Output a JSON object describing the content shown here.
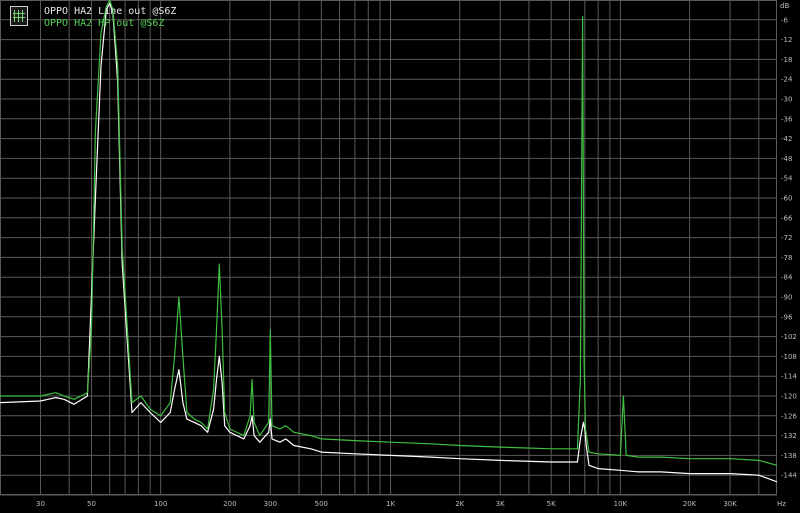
{
  "chart_data": {
    "type": "line",
    "title": "",
    "xlabel": "",
    "ylabel": "",
    "x_scale": "log",
    "xlim": [
      20,
      48000
    ],
    "ylim": [
      -150,
      0
    ],
    "grid": true,
    "legend": "top-left",
    "colors": {
      "background": "#000000",
      "grid": "#5a5a5a",
      "series": [
        "#ffffff",
        "#3fbf3f"
      ]
    },
    "y_ticks": [
      "-6",
      "-12",
      "-18",
      "-24",
      "-30",
      "-36",
      "-42",
      "-48",
      "-54",
      "-60",
      "-66",
      "-72",
      "-78",
      "-84",
      "-90",
      "-96",
      "-102",
      "-108",
      "-114",
      "-120",
      "-126",
      "-132",
      "-138",
      "-144"
    ],
    "y_unit": "dB",
    "x_ticks": [
      {
        "v": 30,
        "label": "30"
      },
      {
        "v": 50,
        "label": "50"
      },
      {
        "v": 100,
        "label": "100"
      },
      {
        "v": 200,
        "label": "200"
      },
      {
        "v": 300,
        "label": "300"
      },
      {
        "v": 500,
        "label": "500"
      },
      {
        "v": 1000,
        "label": "1K"
      },
      {
        "v": 2000,
        "label": "2K"
      },
      {
        "v": 3000,
        "label": "3K"
      },
      {
        "v": 5000,
        "label": "5K"
      },
      {
        "v": 10000,
        "label": "10K"
      },
      {
        "v": 20000,
        "label": "20K"
      },
      {
        "v": 30000,
        "label": "30K"
      }
    ],
    "x_unit": "Hz",
    "series": [
      {
        "name": "OPPO HA2 Line out @S6Z",
        "x": [
          20,
          30,
          35,
          38,
          42,
          48,
          52,
          55,
          58,
          60,
          62,
          65,
          68,
          75,
          82,
          90,
          100,
          110,
          115,
          120,
          125,
          130,
          140,
          150,
          160,
          170,
          175,
          180,
          185,
          190,
          200,
          230,
          245,
          250,
          255,
          270,
          295,
          300,
          305,
          330,
          350,
          380,
          450,
          500,
          700,
          1000,
          1500,
          2000,
          3000,
          5000,
          6500,
          6700,
          6900,
          7000,
          7100,
          7300,
          8000,
          10000,
          12000,
          15000,
          20000,
          30000,
          40000,
          48000
        ],
        "y": [
          -122,
          -121.5,
          -120.5,
          -121,
          -122.5,
          -120,
          -60,
          -20,
          -3,
          -1,
          -4,
          -25,
          -80,
          -125,
          -122,
          -125,
          -128,
          -125,
          -118,
          -112,
          -122,
          -127,
          -128,
          -129,
          -131,
          -124,
          -115,
          -108,
          -116,
          -129,
          -131,
          -133,
          -129,
          -126,
          -132,
          -134,
          -131,
          -127,
          -133,
          -134,
          -133,
          -135,
          -136,
          -137,
          -137.5,
          -138,
          -138.5,
          -139,
          -139.5,
          -140,
          -140,
          -133,
          -128,
          -130,
          -135,
          -141,
          -142,
          -142.5,
          -143,
          -143,
          -143.5,
          -143.5,
          -144,
          -146
        ]
      },
      {
        "name": "OPPO HA2 HP out @S6Z",
        "x": [
          20,
          30,
          35,
          38,
          42,
          48,
          50,
          52,
          55,
          58,
          60,
          62,
          65,
          68,
          75,
          82,
          90,
          100,
          110,
          115,
          120,
          125,
          130,
          140,
          150,
          160,
          170,
          175,
          180,
          185,
          190,
          200,
          230,
          245,
          250,
          255,
          270,
          295,
          300,
          305,
          330,
          350,
          380,
          450,
          500,
          700,
          1000,
          1500,
          2000,
          3000,
          5000,
          6500,
          6700,
          6850,
          6950,
          7050,
          7300,
          8000,
          10000,
          10300,
          10600,
          12000,
          15000,
          20000,
          30000,
          40000,
          48000
        ],
        "y": [
          -120,
          -120,
          -119,
          -120,
          -121,
          -119,
          -100,
          -40,
          -10,
          -2,
          0,
          -3,
          -20,
          -75,
          -122,
          -120,
          -124,
          -126,
          -122,
          -108,
          -90,
          -108,
          -125,
          -127,
          -128,
          -130,
          -118,
          -100,
          -80,
          -100,
          -125,
          -130,
          -132,
          -126,
          -115,
          -128,
          -132,
          -128,
          -100,
          -129,
          -130,
          -129,
          -131,
          -132,
          -133,
          -133.5,
          -134,
          -134.5,
          -135,
          -135.5,
          -136,
          -136,
          -115,
          -5,
          -110,
          -130,
          -137,
          -137.5,
          -138,
          -120,
          -138,
          -138.5,
          -138.5,
          -139,
          -139,
          -139.5,
          -141
        ]
      }
    ]
  }
}
